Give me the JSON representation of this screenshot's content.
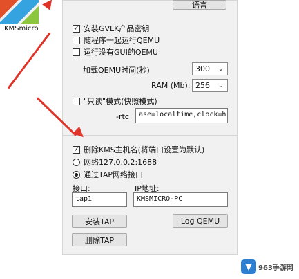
{
  "desktop": {
    "app_label": "KMSmicro"
  },
  "top_button": {
    "label": "语言"
  },
  "options": {
    "install_gvlk": "安装GVLK产品密钥",
    "run_with_qemu": "随程序一起运行QEMU",
    "run_without_gui": "运行没有GUI的QEMU",
    "load_qemu_time_label": "加载QEMU时间(秒)",
    "load_qemu_time_value": "300",
    "ram_label": "RAM (Mb):",
    "ram_value": "256",
    "readonly_mode": "\"只读\"模式(快照模式)",
    "rtc_label": "-rtc",
    "rtc_value": "ase=localtime,clock=h"
  },
  "network": {
    "delete_kms_host": "删除KMS主机名(将端口设置为默认)",
    "network_loopback": "网络127.0.0.2:1688",
    "via_tap": "通过TAP网络接口",
    "interface_label": "接口:",
    "interface_value": "tap1",
    "ip_label": "IP地址:",
    "ip_value": "KMSMICRO-PC",
    "install_tap": "安装TAP",
    "uninstall_tap": "删除TAP",
    "log_qemu": "Log QEMU"
  },
  "state": {
    "install_gvlk_checked": true,
    "run_with_qemu_checked": false,
    "run_without_gui_checked": false,
    "readonly_checked": false,
    "delete_kms_checked": true,
    "selected_network": "via_tap"
  },
  "colors": {
    "arrow": "#e0342b",
    "panel_bg": "#f1f1f1"
  },
  "watermark": {
    "text": "963手游网"
  }
}
